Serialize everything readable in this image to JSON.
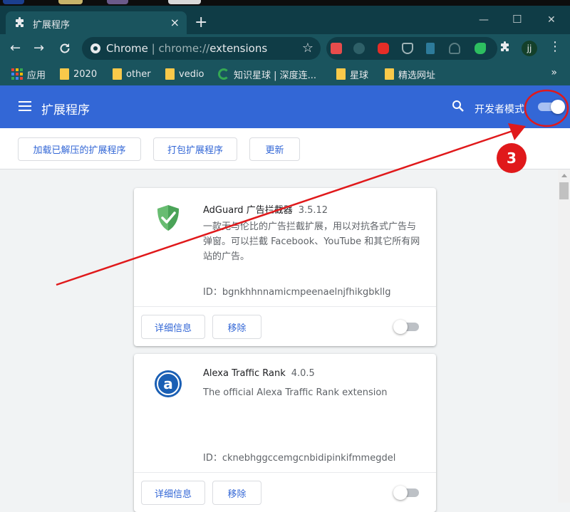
{
  "window": {
    "tab_title": "扩展程序",
    "close_glyph": "×",
    "new_tab_glyph": "+",
    "minimize_glyph": "—",
    "maximize_glyph": "☐",
    "close_window_glyph": "✕"
  },
  "toolbar": {
    "back_glyph": "←",
    "forward_glyph": "→",
    "reload_glyph": "C",
    "url_host": "Chrome",
    "url_separator": " | ",
    "url_scheme": "chrome://",
    "url_path": "extensions",
    "star_glyph": "☆",
    "avatar_text": "jj",
    "menu_glyph": "⋮",
    "extension_icons": [
      "red-gear-icon",
      "radiation-icon",
      "youtube-icon",
      "pocket-icon",
      "document-icon",
      "lightbulb-icon",
      "evernote-icon"
    ]
  },
  "bookmarks": {
    "items": [
      "应用",
      "2020",
      "other",
      "vedio",
      "知识星球 | 深度连...",
      "星球",
      "精选网址"
    ],
    "overflow": "»"
  },
  "header": {
    "title": "扩展程序",
    "dev_mode_label": "开发者模式",
    "dev_mode_on": true
  },
  "actions": {
    "load_unpacked": "加载已解压的扩展程序",
    "pack_extension": "打包扩展程序",
    "update": "更新"
  },
  "extensions": [
    {
      "name": "AdGuard 广告拦截器",
      "version": "3.5.12",
      "description": "一款无与伦比的广告拦截扩展，用以对抗各式广告与弹窗。可以拦截 Facebook、YouTube 和其它所有网站的广告。",
      "id_text": "ID：bgnkhhnnamicmpeenaelnjfhikgbkllg",
      "details_label": "详细信息",
      "remove_label": "移除",
      "enabled": false,
      "icon": "shield-check-icon"
    },
    {
      "name": "Alexa Traffic Rank",
      "version": "4.0.5",
      "description": "The official Alexa Traffic Rank extension",
      "id_text": "ID：cknebhggccemgcnbidipinkifmmegdel",
      "details_label": "详细信息",
      "remove_label": "移除",
      "enabled": false,
      "icon": "alexa-a-icon"
    }
  ],
  "annotation": {
    "step_number": "3",
    "color": "#e0191b"
  },
  "colors": {
    "header_blue": "#3367d6",
    "toolbar_teal": "#1a545e",
    "titlebar_teal": "#0f3c46"
  }
}
